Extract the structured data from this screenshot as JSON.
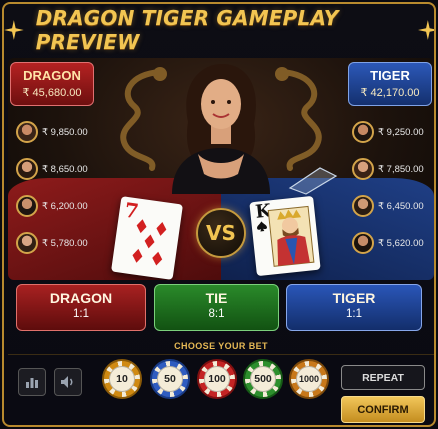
{
  "header": {
    "title": "DRAGON TIGER GAMEPLAY PREVIEW"
  },
  "dragon_panel": {
    "name": "DRAGON",
    "total": "₹ 45,680.00",
    "players": [
      {
        "amount": "₹ 9,850.00"
      },
      {
        "amount": "₹ 8,650.00"
      },
      {
        "amount": "₹ 6,200.00"
      },
      {
        "amount": "₹ 5,780.00"
      }
    ]
  },
  "tiger_panel": {
    "name": "TIGER",
    "total": "₹ 42,170.00",
    "players": [
      {
        "amount": "₹ 9,250.00"
      },
      {
        "amount": "₹ 7,850.00"
      },
      {
        "amount": "₹ 6,450.00"
      },
      {
        "amount": "₹ 5,620.00"
      }
    ]
  },
  "cards": {
    "dragon_card": {
      "rank": "7",
      "suit": "diamonds",
      "color": "#d22020"
    },
    "tiger_card": {
      "rank": "K",
      "suit": "spades",
      "color": "#111111"
    }
  },
  "vs_label": "VS",
  "bet_zones": [
    {
      "name": "DRAGON",
      "odds": "1:1",
      "color": "#a82121"
    },
    {
      "name": "TIE",
      "odds": "8:1",
      "color": "#2a8a2a"
    },
    {
      "name": "TIGER",
      "odds": "1:1",
      "color": "#2a56b8"
    }
  ],
  "choose_label": "CHOOSE YOUR BET",
  "chips": [
    {
      "value": "10",
      "color": "#d08a12"
    },
    {
      "value": "50",
      "color": "#2f5cc0"
    },
    {
      "value": "100",
      "color": "#c42424"
    },
    {
      "value": "500",
      "color": "#2d8f2d"
    },
    {
      "value": "1000",
      "color": "#c8781a"
    }
  ],
  "controls": {
    "stats_icon": "bar-chart-icon",
    "sound_icon": "speaker-icon",
    "repeat_label": "REPEAT",
    "confirm_label": "CONFIRM"
  },
  "colors": {
    "accent_gold": "#f2c552",
    "dragon_red": "#a82121",
    "tiger_blue": "#2a56b8",
    "tie_green": "#2a8a2a"
  }
}
